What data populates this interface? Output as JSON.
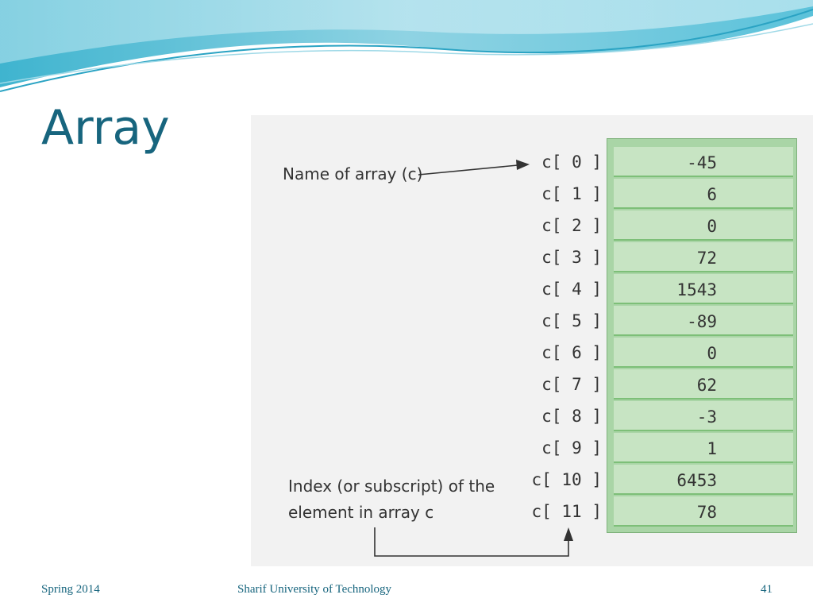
{
  "slide": {
    "title": "Array",
    "footer_left": "Spring 2014",
    "footer_center": "Sharif University of Technology",
    "page_number": "41"
  },
  "figure": {
    "name_label": "Name of array (c)",
    "index_label_line1": "Index (or subscript) of the",
    "index_label_line2": "element in array c",
    "elements": [
      {
        "index": "c[ 0 ]",
        "value": "-45"
      },
      {
        "index": "c[ 1 ]",
        "value": "6"
      },
      {
        "index": "c[ 2 ]",
        "value": "0"
      },
      {
        "index": "c[ 3 ]",
        "value": "72"
      },
      {
        "index": "c[ 4 ]",
        "value": "1543"
      },
      {
        "index": "c[ 5 ]",
        "value": "-89"
      },
      {
        "index": "c[ 6 ]",
        "value": "0"
      },
      {
        "index": "c[ 7 ]",
        "value": "62"
      },
      {
        "index": "c[ 8 ]",
        "value": "-3"
      },
      {
        "index": "c[ 9 ]",
        "value": "1"
      },
      {
        "index": "c[ 10 ]",
        "value": "6453"
      },
      {
        "index": "c[ 11 ]",
        "value": "78"
      }
    ]
  },
  "colors": {
    "title": "#17657e",
    "cell_fill": "#c7e4c3",
    "cell_border": "#7dbf78"
  }
}
